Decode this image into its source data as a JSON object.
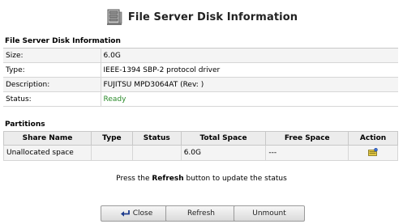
{
  "header": {
    "title": "File Server Disk Information",
    "icon": "file-server-icon"
  },
  "info": {
    "heading": "File Server Disk Information",
    "rows": [
      {
        "label": "Size:",
        "value": "6.0G"
      },
      {
        "label": "Type:",
        "value": "IEEE-1394 SBP-2 protocol driver"
      },
      {
        "label": "Description:",
        "value": "FUJITSU MPD3064AT (Rev: )"
      },
      {
        "label": "Status:",
        "value": "Ready"
      }
    ],
    "status_color": "#2a8a2a"
  },
  "partitions": {
    "heading": "Partitions",
    "columns": [
      "Share Name",
      "Type",
      "Status",
      "Total Space",
      "Free Space",
      "Action"
    ],
    "rows": [
      {
        "share_name": "Unallocated space",
        "type": "",
        "status": "",
        "total_space": "6.0G",
        "free_space": "---",
        "action_icon": "create-share-icon"
      }
    ]
  },
  "hint": {
    "prefix": "Press the",
    "bold": "Refresh",
    "suffix": "button to update the status"
  },
  "buttons": {
    "close": "Close",
    "refresh": "Refresh",
    "unmount": "Unmount"
  }
}
